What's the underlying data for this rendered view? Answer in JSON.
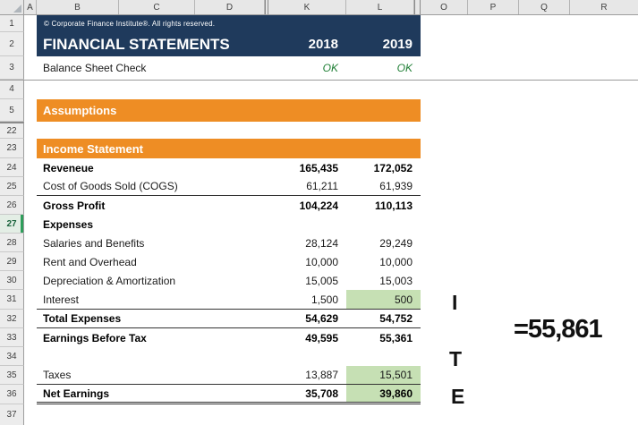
{
  "column_headers": [
    "A",
    "B",
    "C",
    "D",
    "K",
    "L",
    "O",
    "P",
    "Q",
    "R"
  ],
  "row_numbers": [
    "1",
    "2",
    "3",
    "4",
    "5",
    "22",
    "23",
    "24",
    "25",
    "26",
    "27",
    "28",
    "29",
    "30",
    "31",
    "32",
    "33",
    "34",
    "35",
    "36",
    "37"
  ],
  "title_block": {
    "copyright": "© Corporate Finance Institute®. All rights reserved.",
    "title": "FINANCIAL STATEMENTS",
    "year_2018": "2018",
    "year_2019": "2019"
  },
  "balance_check": {
    "label": "Balance Sheet Check",
    "value_2018": "OK",
    "value_2019": "OK"
  },
  "sections": {
    "assumptions": "Assumptions",
    "income_statement": "Income Statement"
  },
  "income": {
    "rows": [
      {
        "label": "Reveneue",
        "y2018": "165,435",
        "y2019": "172,052"
      },
      {
        "label": "Cost of Goods Sold (COGS)",
        "y2018": "61,211",
        "y2019": "61,939"
      },
      {
        "label": "Gross Profit",
        "y2018": "104,224",
        "y2019": "110,113"
      },
      {
        "label": "Expenses",
        "y2018": "",
        "y2019": ""
      },
      {
        "label": "Salaries and Benefits",
        "y2018": "28,124",
        "y2019": "29,249"
      },
      {
        "label": "Rent and Overhead",
        "y2018": "10,000",
        "y2019": "10,000"
      },
      {
        "label": "Depreciation & Amortization",
        "y2018": "15,005",
        "y2019": "15,003"
      },
      {
        "label": "Interest",
        "y2018": "1,500",
        "y2019": "500"
      },
      {
        "label": "Total Expenses",
        "y2018": "54,629",
        "y2019": "54,752"
      },
      {
        "label": "Earnings Before Tax",
        "y2018": "49,595",
        "y2019": "55,361"
      },
      {
        "label": "",
        "y2018": "",
        "y2019": ""
      },
      {
        "label": "Taxes",
        "y2018": "13,887",
        "y2019": "15,501"
      },
      {
        "label": "Net Earnings",
        "y2018": "35,708",
        "y2019": "39,860"
      },
      {
        "label": "",
        "y2018": "",
        "y2019": ""
      }
    ]
  },
  "annotations": {
    "letter_i": "I",
    "letter_t": "T",
    "letter_e": "E",
    "formula_result": "=55,861"
  },
  "colors": {
    "navy_banner": "#1f3a5c",
    "orange_banner": "#ee8d24",
    "highlight_green_fill": "#c6e0b4",
    "ok_green_text": "#1e7e34",
    "active_row_accent": "#2e9e5b"
  }
}
